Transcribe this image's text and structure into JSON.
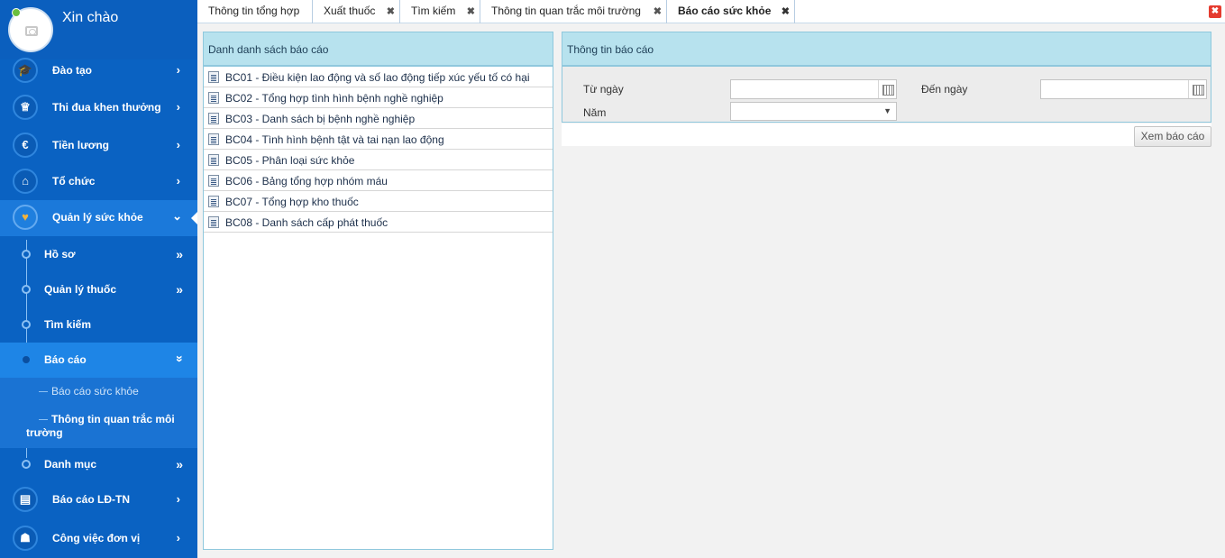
{
  "user": {
    "greeting": "Xin chào"
  },
  "sidebar": {
    "items": [
      {
        "label": "Đào tạo",
        "icon": "graduation-cap-icon"
      },
      {
        "label": "Thi đua khen thưởng",
        "icon": "trophy-icon"
      },
      {
        "label": "Tiền lương",
        "icon": "euro-icon"
      },
      {
        "label": "Tổ chức",
        "icon": "bank-icon"
      },
      {
        "label": "Quản lý sức khỏe",
        "icon": "heart-icon",
        "active": true
      },
      {
        "label": "Báo cáo LĐ-TN",
        "icon": "id-card-icon"
      },
      {
        "label": "Công việc đơn vị",
        "icon": "building-icon"
      }
    ],
    "health_sub": [
      {
        "label": "Hồ sơ"
      },
      {
        "label": "Quản lý thuốc"
      },
      {
        "label": "Tìm kiếm"
      },
      {
        "label": "Báo cáo",
        "active": true
      },
      {
        "label": "Danh mục"
      }
    ],
    "report_sub": [
      {
        "label": "Báo cáo sức khỏe"
      },
      {
        "label_line1": "Thông tin quan trắc môi",
        "label_line2": "trường"
      }
    ]
  },
  "tabs": [
    {
      "label": "Thông tin tổng hợp",
      "closable": false
    },
    {
      "label": "Xuất thuốc",
      "closable": true
    },
    {
      "label": "Tìm kiếm",
      "closable": true
    },
    {
      "label": "Thông tin quan trắc môi trường",
      "closable": true
    },
    {
      "label": "Báo cáo sức khỏe",
      "closable": true,
      "active": true
    }
  ],
  "close_glyph": "✖",
  "report_list": {
    "title": "Danh danh sách báo cáo",
    "items": [
      "BC01 - Điều kiện lao động và số lao động tiếp xúc yếu tố có hại",
      "BC02 - Tổng hợp tình hình bệnh nghề nghiệp",
      "BC03 - Danh sách bị bệnh nghề nghiệp",
      "BC04 - Tình hình bệnh tật và tai nạn lao động",
      "BC05 - Phân loại sức khỏe",
      "BC06 - Bảng tổng hợp nhóm máu",
      "BC07 - Tổng hợp kho thuốc",
      "BC08 - Danh sách cấp phát thuốc"
    ]
  },
  "report_info": {
    "title": "Thông tin báo cáo",
    "from_label": "Từ ngày",
    "from_value": "",
    "to_label": "Đến ngày",
    "to_value": "",
    "year_label": "Năm",
    "year_value": ""
  },
  "view_button": "Xem báo cáo",
  "colors": {
    "sidebar": "#0a62c2",
    "panel_header": "#b7e2ee",
    "close_all": "#e53b2f"
  }
}
